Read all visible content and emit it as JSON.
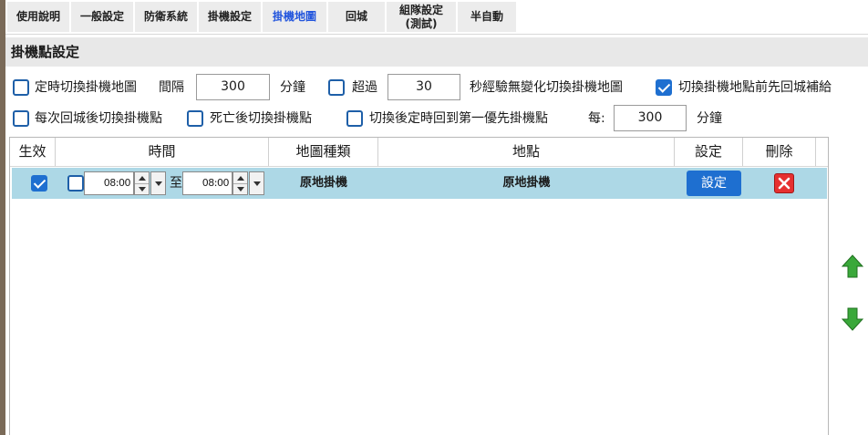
{
  "tabs": [
    {
      "label": "使用說明",
      "active": false
    },
    {
      "label": "一般設定",
      "active": false
    },
    {
      "label": "防衛系統",
      "active": false
    },
    {
      "label": "掛機設定",
      "active": false
    },
    {
      "label": "掛機地圖",
      "active": true
    },
    {
      "label": "回城",
      "active": false
    },
    {
      "label": "組隊設定\n(測試)",
      "active": false
    },
    {
      "label": "半自動",
      "active": false
    }
  ],
  "section_title": "掛機點設定",
  "options": {
    "timed_switch": {
      "label": "定時切換掛機地圖",
      "checked": false
    },
    "interval_label": "間隔",
    "interval_value": "300",
    "interval_unit": "分鐘",
    "exceed": {
      "label": "超過",
      "checked": false
    },
    "exceed_value": "30",
    "exceed_suffix": "秒經驗無變化切換掛機地圖",
    "return_before_switch": {
      "label": "切換掛機地點前先回城補給",
      "checked": true
    },
    "switch_after_return": {
      "label": "每次回城後切換掛機點",
      "checked": false
    },
    "switch_after_death": {
      "label": "死亡後切換掛機點",
      "checked": false
    },
    "back_to_first": {
      "label": "切換後定時回到第一優先掛機點",
      "checked": false
    },
    "every_label": "每:",
    "every_value": "300",
    "every_unit": "分鐘"
  },
  "grid": {
    "headers": {
      "enabled": "生效",
      "time": "時間",
      "map_type": "地圖種類",
      "location": "地點",
      "settings": "設定",
      "delete": "刪除"
    },
    "rows": [
      {
        "enabled": true,
        "time_enabled": false,
        "start_time": "08:00",
        "to_label": "至",
        "end_time": "08:00",
        "map_type": "原地掛機",
        "location": "原地掛機",
        "settings_button": "設定"
      }
    ]
  },
  "icons": {
    "move_up": "green-up-arrow-icon",
    "move_down": "green-down-arrow-icon",
    "delete": "red-x-icon"
  },
  "colors": {
    "accent": "#1e6fd0",
    "active_tab": "#2255dd",
    "selected_row": "#add8e6",
    "delete_red": "#e63030",
    "arrow_green": "#3aa83a"
  }
}
